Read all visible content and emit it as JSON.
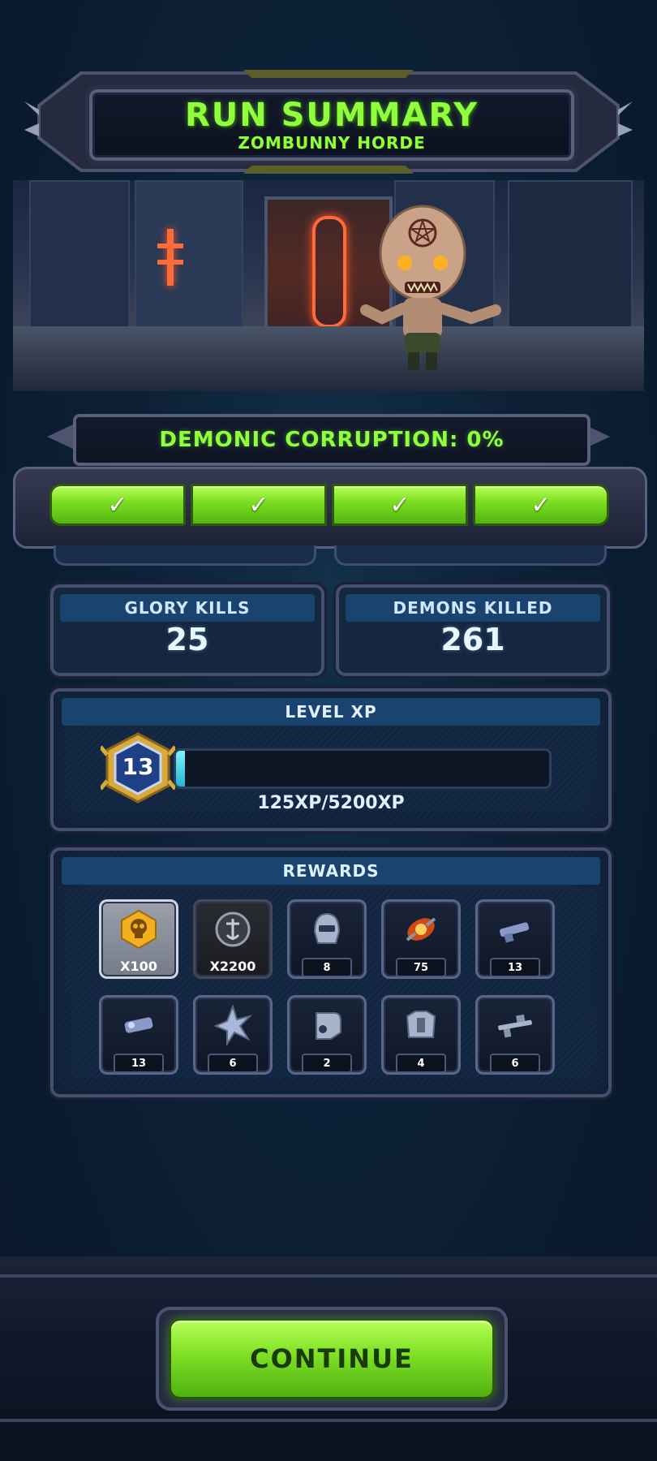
{
  "header": {
    "title": "RUN SUMMARY",
    "subtitle": "ZOMBUNNY HORDE"
  },
  "corruption": {
    "label": "DEMONIC CORRUPTION: 0%",
    "segments": 4,
    "segments_complete": 4,
    "check_glyph": "✓"
  },
  "stats": {
    "glory_kills_label": "GLORY KILLS",
    "glory_kills_value": "25",
    "demons_killed_label": "DEMONS KILLED",
    "demons_killed_value": "261"
  },
  "level": {
    "title": "LEVEL XP",
    "level": "13",
    "xp_text": "125XP/5200XP",
    "progress_fraction": 0.024
  },
  "rewards": {
    "title": "REWARDS",
    "items": [
      {
        "icon": "gold-skull-coin-icon",
        "count": "X100"
      },
      {
        "icon": "dark-rune-coin-icon",
        "count": "X2200"
      },
      {
        "icon": "helmet-icon",
        "count": "8"
      },
      {
        "icon": "demon-gem-icon",
        "count": "75"
      },
      {
        "icon": "shotgun-icon",
        "count": "13"
      },
      {
        "icon": "plasma-gun-icon",
        "count": "13"
      },
      {
        "icon": "spiked-star-icon",
        "count": "6"
      },
      {
        "icon": "armor-piece-icon",
        "count": "2"
      },
      {
        "icon": "chest-armor-icon",
        "count": "4"
      },
      {
        "icon": "rifle-icon",
        "count": "6"
      }
    ]
  },
  "footer": {
    "continue_label": "CONTINUE"
  },
  "colors": {
    "accent_green": "#8fff3c",
    "panel_blue": "#1b4370",
    "xp_cyan": "#4fd3ee"
  }
}
